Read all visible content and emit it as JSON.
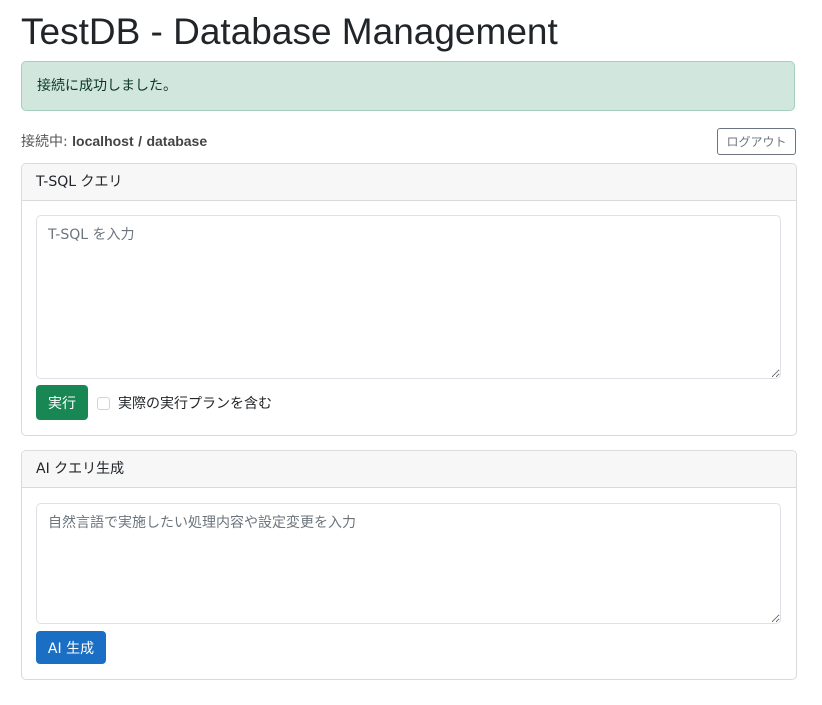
{
  "header": {
    "title": "TestDB - Database Management"
  },
  "alert": {
    "message": "接続に成功しました。"
  },
  "connection": {
    "prefix": "接続中:",
    "host": "localhost",
    "separator": "/",
    "database": "database",
    "logout_label": "ログアウト"
  },
  "tsql_card": {
    "title": "T-SQL クエリ",
    "query_value": "",
    "query_placeholder": "T-SQL を入力",
    "execute_label": "実行",
    "include_plan_label": "実際の実行プランを含む",
    "include_plan_checked": false
  },
  "ai_card": {
    "title": "AI クエリ生成",
    "prompt_value": "",
    "prompt_placeholder": "自然言語で実施したい処理内容や設定変更を入力",
    "generate_label": "AI 生成"
  },
  "colors": {
    "alert_bg": "#d1e7dd",
    "execute_button": "#198754",
    "ai_button": "#1a6ec4"
  }
}
